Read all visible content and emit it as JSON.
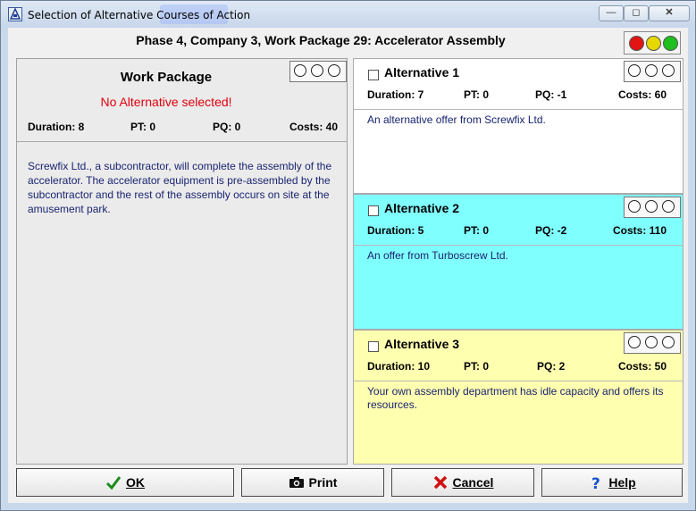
{
  "window": {
    "title": "Selection of Alternative Courses of Action",
    "minimize_glyph": "—",
    "maximize_glyph": "◻",
    "close_glyph": "✕"
  },
  "header": {
    "title": "Phase 4, Company 3, Work Package 29: Accelerator Assembly",
    "lights": [
      "#e21414",
      "#e6d800",
      "#1fbf1f"
    ]
  },
  "work_package": {
    "title": "Work Package",
    "message": "No Alternative selected!",
    "duration": "Duration: 8",
    "pt": "PT: 0",
    "pq": "PQ: 0",
    "costs": "Costs: 40",
    "description": "Screwfix Ltd., a subcontractor, will complete the assembly of the accelerator. The accelerator equipment is pre-assembled by the subcontractor and the rest of the assembly occurs on site at the amusement park."
  },
  "alternatives": [
    {
      "title": "Alternative 1",
      "duration": "Duration: 7",
      "pt": "PT: 0",
      "pq": "PQ: -1",
      "costs": "Costs: 60",
      "description": "An alternative offer from Screwfix Ltd.",
      "color": "#ffffff"
    },
    {
      "title": "Alternative 2",
      "duration": "Duration: 5",
      "pt": "PT: 0",
      "pq": "PQ: -2",
      "costs": "Costs: 110",
      "description": "An offer from Turboscrew Ltd.",
      "color": "#80ffff"
    },
    {
      "title": "Alternative 3",
      "duration": "Duration: 10",
      "pt": "PT: 0",
      "pq": "PQ: 2",
      "costs": "Costs: 50",
      "description": "Your own assembly department has idle capacity and offers its resources.",
      "color": "#ffffb0"
    }
  ],
  "buttons": {
    "ok": "OK",
    "print": "Print",
    "cancel": "Cancel",
    "help": "Help"
  }
}
